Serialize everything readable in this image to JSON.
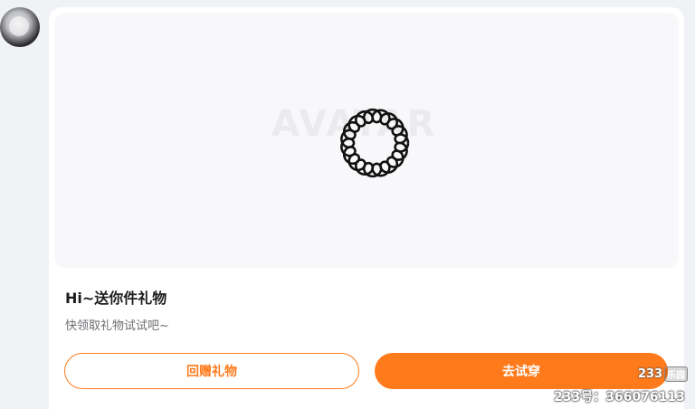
{
  "avatar": {
    "icon": "user-avatar"
  },
  "preview": {
    "watermark": "AVATAR",
    "spinner_icon": "loading-spinner-icon"
  },
  "gift": {
    "title": "Hi~送你件礼物",
    "subtitle": "快领取礼物试试吧~"
  },
  "buttons": {
    "return_gift": "回赠礼物",
    "try_on": "去试穿"
  },
  "overlay": {
    "brand": "233",
    "brand_tag": "乐园",
    "uid_text": "233号：366076113"
  },
  "colors": {
    "accent": "#ff7a1a",
    "background": "#f1f2f6",
    "card": "#ffffff",
    "preview_bg": "#f8f8fb",
    "title_text": "#1d1d1f",
    "subtitle_text": "#6d6d72"
  }
}
